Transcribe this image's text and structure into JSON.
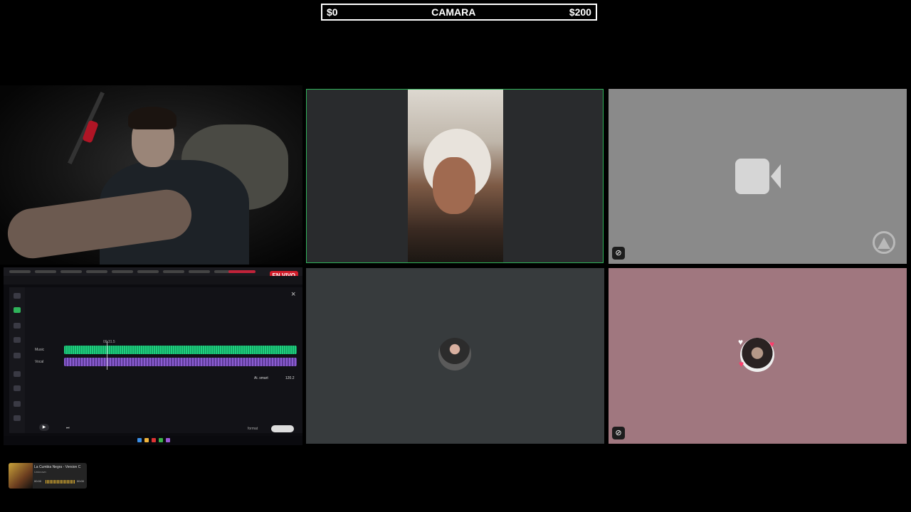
{
  "topbar": {
    "left_amount": "$0",
    "title": "CAMARA",
    "right_amount": "$200"
  },
  "desktop": {
    "live_badge": "EN VIVO",
    "close_icon": "×",
    "tracks": {
      "music_label": "Music",
      "vocal_label": "Vocal",
      "playhead_time": "00:31.5"
    },
    "footer": {
      "format_label": "format",
      "tempo_label": "Ai. smart",
      "bpm_value": "120.2"
    }
  },
  "tiles": [
    {
      "id": "tile-speaker",
      "state": "video",
      "active": true
    },
    {
      "id": "tile-camera-off",
      "state": "camera-off",
      "icon": "video-camera-icon",
      "muted": true
    },
    {
      "id": "tile-avatar-1",
      "state": "avatar"
    },
    {
      "id": "tile-avatar-2",
      "state": "avatar",
      "muted": true
    }
  ],
  "now_playing": {
    "title": "La Cumbia Negra - Version C",
    "artist": "Unknown",
    "time_start": "00:00",
    "time_end": "00:00"
  },
  "colors": {
    "active_border": "#2fb35a",
    "live_red": "#d21c2a",
    "tile_pink": "#a0777f",
    "tile_gray": "#8a8a8a"
  }
}
